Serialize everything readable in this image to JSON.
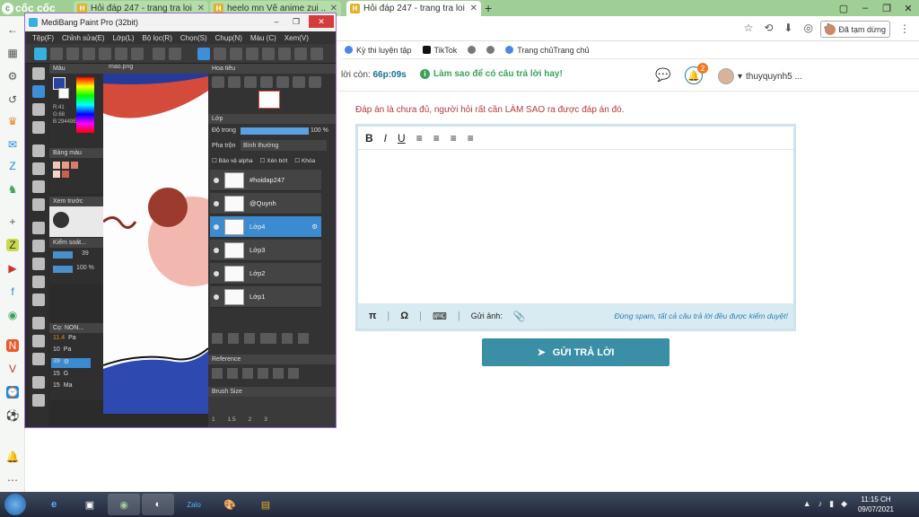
{
  "browser": {
    "brand": "cốc cốc",
    "tabs": [
      {
        "title": "Hỏi đáp 247 - trang tra loi",
        "active": false
      },
      {
        "title": "heelo mn Vẽ anime zui ......",
        "active": false
      },
      {
        "title": "Hỏi đáp 247 - trang tra loi",
        "active": true
      }
    ],
    "new_tab": "+",
    "logged_in_label": "Đã tạm dừng",
    "bookmarks": [
      "Kỳ thi luyện tập",
      "TikTok",
      "Trang chủTrang chủ"
    ]
  },
  "site": {
    "timer_label": "lời còn:",
    "timer_value": "66p:09s",
    "tip": "Làm sao để có câu trả lời hay!",
    "notification_count": "2",
    "username": "thuyquynh5 ...",
    "answer_note": "Đáp án là chưa đủ, người hỏi rất cần LÀM SAO ra được đáp án đó.",
    "editor": {
      "bold": "B",
      "italic": "I",
      "underline": "U",
      "pi": "π",
      "omega": "Ω",
      "attach_label": "Gửi ảnh:",
      "spam_note": "Đừng spam, tất cả câu trả lời đều được kiểm duyệt!"
    },
    "submit_label": "GỬI TRẢ LỜI"
  },
  "medibang": {
    "title": "MediBang Paint Pro (32bit)",
    "menu": [
      "Tệp(F)",
      "Chỉnh sửa(E)",
      "Lớp(L)",
      "Bộ lọc(R)",
      "Chọn(S)",
      "Chụp(N)",
      "Màu (C)",
      "Xem(V)"
    ],
    "color_panel": "Màu",
    "color_values": [
      "R:41",
      "G:68",
      "B:29449E"
    ],
    "palette_panel": "Bảng màu",
    "preview_panel": "Xem trước",
    "control_panel": "Kiểm soát...",
    "brush_size": "39",
    "opacity_pct": "100 %",
    "brush_panel": "Cọ: NON...",
    "brush_list": [
      {
        "size": "11.4",
        "name": "Pa"
      },
      {
        "size": "10",
        "name": "Pa"
      },
      {
        "size": "39",
        "name": ""
      },
      {
        "size": "15",
        "name": "G"
      },
      {
        "size": "15",
        "name": "Ma"
      }
    ],
    "canvas_tab": "mao.png",
    "navigator_panel": "Hoa tiêu",
    "layer_panel": "Lớp",
    "opacity_label": "Độ trong",
    "layer_opacity": "100 %",
    "blend_label": "Pha trộn",
    "blend_mode": "Bình thường",
    "protect_alpha": "Bảo vệ alpha",
    "clipping": "Xén bớt",
    "lock": "Khóa",
    "layers": [
      {
        "name": "#hoidap247",
        "selected": false
      },
      {
        "name": "@Quynh",
        "selected": false
      },
      {
        "name": "Lớp4",
        "selected": true
      },
      {
        "name": "Lớp3",
        "selected": false
      },
      {
        "name": "Lớp2",
        "selected": false
      },
      {
        "name": "Lớp1",
        "selected": false
      }
    ],
    "reference_panel": "Reference",
    "brushsize_panel": "Brush Size",
    "brushsize_values": [
      "1",
      "1.5",
      "2",
      "3"
    ]
  },
  "taskbar": {
    "time": "11:15 CH",
    "date": "09/07/2021"
  },
  "colors": {
    "browser_green": "#9fcf94",
    "accent_teal": "#3a8ea5",
    "note_red": "#b53a3a",
    "tip_green": "#3aa35a",
    "layer_selected": "#3b8bd0"
  }
}
